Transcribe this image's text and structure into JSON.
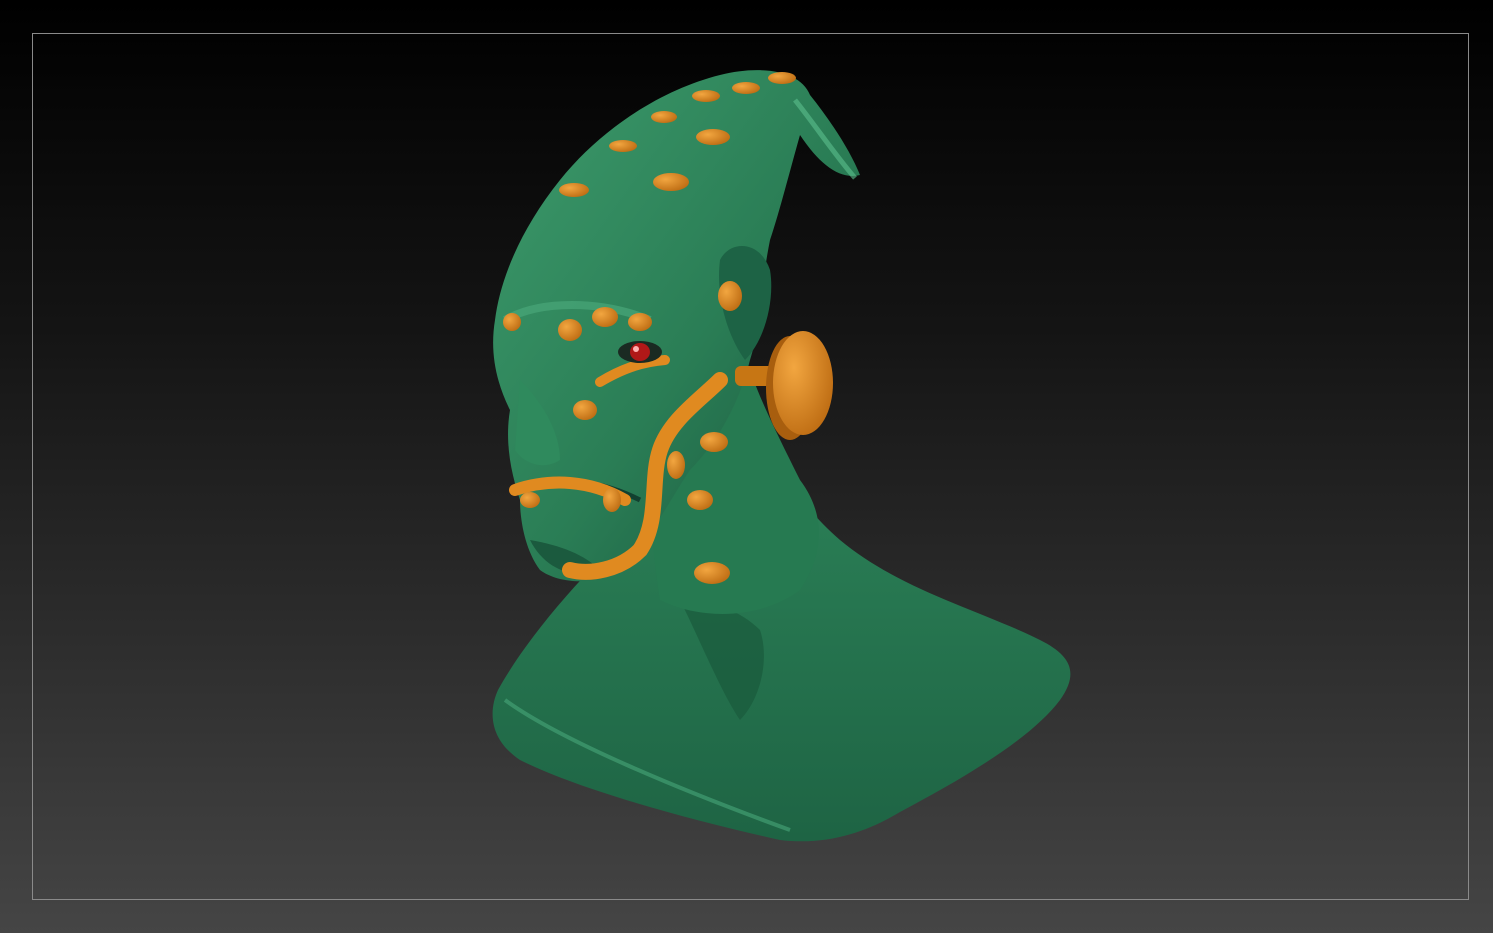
{
  "viewport": {
    "background_top": "#000000",
    "background_bottom": "#454545",
    "frame_color": "#8a8a8a"
  },
  "model": {
    "icon": "alien-bust-sculpt",
    "skin_color": "#2e8a5e",
    "skin_shadow": "#1b5a3c",
    "skin_highlight": "#4aa87a",
    "accent_color": "#e08a20",
    "accent_shadow": "#a45c10",
    "eye_color": "#b01818"
  }
}
